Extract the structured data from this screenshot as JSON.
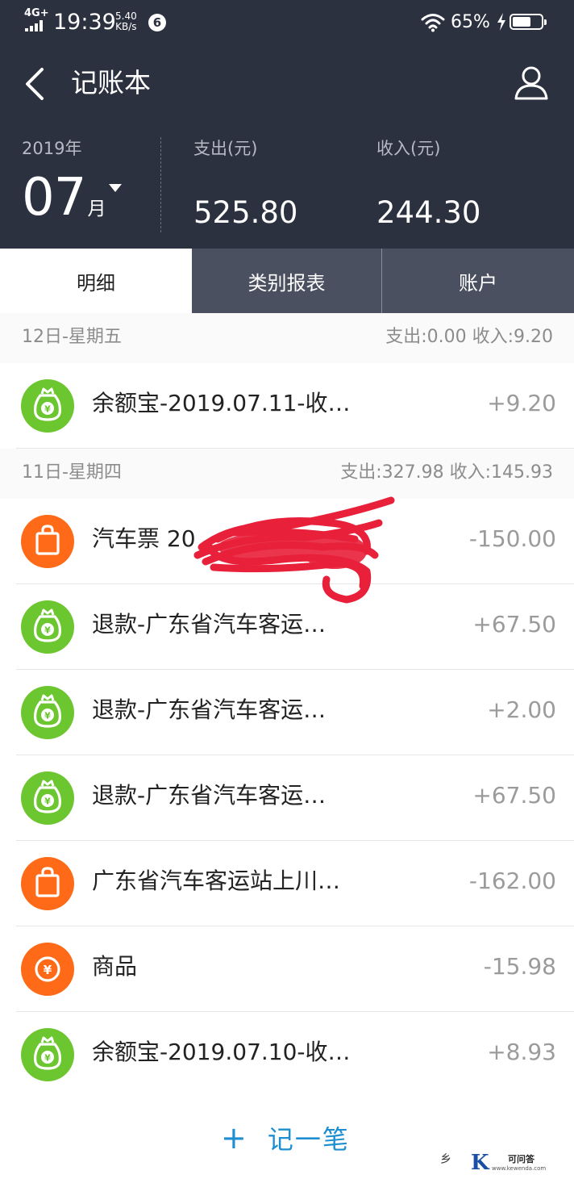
{
  "status_bar": {
    "network": "4G+",
    "time": "19:39",
    "speed_value": "5.40",
    "speed_unit": "KB/s",
    "notification_count": "6",
    "battery_percent": "65%",
    "battery_level": 0.65
  },
  "header": {
    "title": "记账本",
    "year": "2019年",
    "month": "07",
    "month_unit": "月",
    "expense_label": "支出(元)",
    "expense_value": "525.80",
    "income_label": "收入(元)",
    "income_value": "244.30"
  },
  "tabs": [
    {
      "label": "明细",
      "active": true
    },
    {
      "label": "类别报表",
      "active": false
    },
    {
      "label": "账户",
      "active": false
    }
  ],
  "days": [
    {
      "date": "12日-星期五",
      "summary": "支出:0.00 收入:9.20",
      "items": [
        {
          "icon": "money-bag-icon",
          "color": "#6cc630",
          "title": "余额宝-2019.07.11-收…",
          "amount": "+9.20"
        }
      ]
    },
    {
      "date": "11日-星期四",
      "summary": "支出:327.98 收入:145.93",
      "items": [
        {
          "icon": "shopping-bag-icon",
          "color": "#fe6a17",
          "title": "汽车票 20",
          "amount": "-150.00"
        },
        {
          "icon": "money-bag-icon",
          "color": "#6cc630",
          "title": "退款-广东省汽车客运…",
          "amount": "+67.50"
        },
        {
          "icon": "money-bag-icon",
          "color": "#6cc630",
          "title": "退款-广东省汽车客运…",
          "amount": "+2.00"
        },
        {
          "icon": "money-bag-icon",
          "color": "#6cc630",
          "title": "退款-广东省汽车客运…",
          "amount": "+67.50"
        },
        {
          "icon": "shopping-bag-icon",
          "color": "#fe6a17",
          "title": "广东省汽车客运站上川…",
          "amount": "-162.00"
        },
        {
          "icon": "yuan-coin-icon",
          "color": "#fe6a17",
          "title": "商品",
          "amount": "-15.98"
        },
        {
          "icon": "money-bag-icon",
          "color": "#6cc630",
          "title": "余额宝-2019.07.10-收…",
          "amount": "+8.93"
        }
      ]
    }
  ],
  "add_button": {
    "plus": "+",
    "label": "记一笔"
  },
  "watermark": {
    "glyph": "乡",
    "logo": "K",
    "name": "可问答",
    "url": "www.kewenda.com"
  },
  "colors": {
    "header_bg": "#2c3140",
    "income_green": "#6cc630",
    "expense_orange": "#fe6a17",
    "accent_blue": "#1d8fd0"
  }
}
